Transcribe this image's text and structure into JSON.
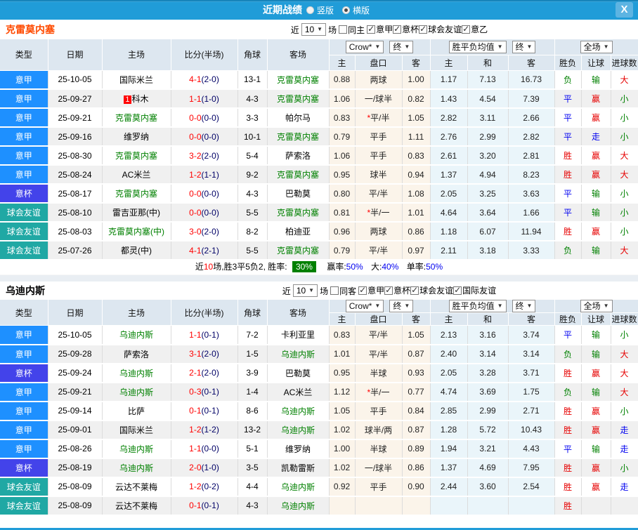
{
  "titlebar": {
    "title": "近期战绩",
    "radio_vertical": "竖版",
    "radio_horizontal": "横版",
    "close": "X"
  },
  "controls": {
    "near_label": "近",
    "count": "10",
    "matches_label": "场"
  },
  "columns": {
    "type": "类型",
    "date": "日期",
    "home": "主场",
    "score": "比分(半场)",
    "corner": "角球",
    "away": "客场",
    "dd_bookmaker": "Crow*",
    "dd_final1": "终",
    "dd_avg": "胜平负均值",
    "dd_final2": "终",
    "dd_full": "全场",
    "sub": [
      "主",
      "盘口",
      "客",
      "主",
      "和",
      "客",
      "胜负",
      "让球",
      "进球数"
    ]
  },
  "type_colors": {
    "意甲": "#1e90ff",
    "意杯": "#4343ea",
    "球会友谊": "#20a8a4"
  },
  "result_colors": {
    "red": "#e60000",
    "green": "#008000",
    "blue": "#0000f0"
  },
  "sections": [
    {
      "team": "克雷莫内塞",
      "same_label": "同主",
      "leagues": [
        "意甲",
        "意杯",
        "球会友谊",
        "意乙"
      ],
      "rows": [
        {
          "type": "意甲",
          "date": "25-10-05",
          "home": "国际米兰",
          "hb": "",
          "hg": 0,
          "ft": "4-1",
          "ht": "(2-0)",
          "corner": "13-1",
          "away": "克雷莫内塞",
          "ag": 1,
          "o1": "0.88",
          "hc": "两球",
          "star": 0,
          "o2": "1.00",
          "a1": "1.17",
          "a2": "7.13",
          "a3": "16.73",
          "r1": "负",
          "r1c": "g",
          "r2": "输",
          "r2c": "g",
          "r3": "大",
          "r3c": "r"
        },
        {
          "type": "意甲",
          "date": "25-09-27",
          "home": "科木",
          "hb": "1",
          "hg": 0,
          "ft": "1-1",
          "ht": "(1-0)",
          "corner": "4-3",
          "away": "克雷莫内塞",
          "ag": 1,
          "o1": "1.06",
          "hc": "一/球半",
          "star": 0,
          "o2": "0.82",
          "a1": "1.43",
          "a2": "4.54",
          "a3": "7.39",
          "r1": "平",
          "r1c": "b",
          "r2": "赢",
          "r2c": "r",
          "r3": "小",
          "r3c": "g"
        },
        {
          "type": "意甲",
          "date": "25-09-21",
          "home": "克雷莫内塞",
          "hb": "",
          "hg": 1,
          "ft": "0-0",
          "ht": "(0-0)",
          "corner": "3-3",
          "away": "帕尔马",
          "ag": 0,
          "o1": "0.83",
          "hc": "平/半",
          "star": 1,
          "o2": "1.05",
          "a1": "2.82",
          "a2": "3.11",
          "a3": "2.66",
          "r1": "平",
          "r1c": "b",
          "r2": "赢",
          "r2c": "r",
          "r3": "小",
          "r3c": "g"
        },
        {
          "type": "意甲",
          "date": "25-09-16",
          "home": "维罗纳",
          "hb": "",
          "hg": 0,
          "ft": "0-0",
          "ht": "(0-0)",
          "corner": "10-1",
          "away": "克雷莫内塞",
          "ag": 1,
          "o1": "0.79",
          "hc": "平手",
          "star": 0,
          "o2": "1.11",
          "a1": "2.76",
          "a2": "2.99",
          "a3": "2.82",
          "r1": "平",
          "r1c": "b",
          "r2": "走",
          "r2c": "b",
          "r3": "小",
          "r3c": "g"
        },
        {
          "type": "意甲",
          "date": "25-08-30",
          "home": "克雷莫内塞",
          "hb": "",
          "hg": 1,
          "ft": "3-2",
          "ht": "(2-0)",
          "corner": "5-4",
          "away": "萨索洛",
          "ag": 0,
          "o1": "1.06",
          "hc": "平手",
          "star": 0,
          "o2": "0.83",
          "a1": "2.61",
          "a2": "3.20",
          "a3": "2.81",
          "r1": "胜",
          "r1c": "r",
          "r2": "赢",
          "r2c": "r",
          "r3": "大",
          "r3c": "r"
        },
        {
          "type": "意甲",
          "date": "25-08-24",
          "home": "AC米兰",
          "hb": "",
          "hg": 0,
          "ft": "1-2",
          "ht": "(1-1)",
          "corner": "9-2",
          "away": "克雷莫内塞",
          "ag": 1,
          "o1": "0.95",
          "hc": "球半",
          "star": 0,
          "o2": "0.94",
          "a1": "1.37",
          "a2": "4.94",
          "a3": "8.23",
          "r1": "胜",
          "r1c": "r",
          "r2": "赢",
          "r2c": "r",
          "r3": "大",
          "r3c": "r"
        },
        {
          "type": "意杯",
          "date": "25-08-17",
          "home": "克雷莫内塞",
          "hb": "",
          "hg": 1,
          "ft": "0-0",
          "ht": "(0-0)",
          "corner": "4-3",
          "away": "巴勒莫",
          "ag": 0,
          "o1": "0.80",
          "hc": "平/半",
          "star": 0,
          "o2": "1.08",
          "a1": "2.05",
          "a2": "3.25",
          "a3": "3.63",
          "r1": "平",
          "r1c": "b",
          "r2": "输",
          "r2c": "g",
          "r3": "小",
          "r3c": "g"
        },
        {
          "type": "球会友谊",
          "date": "25-08-10",
          "home": "雷吉亚那(中)",
          "hb": "",
          "hg": 0,
          "ft": "0-0",
          "ht": "(0-0)",
          "corner": "5-5",
          "away": "克雷莫内塞",
          "ag": 1,
          "o1": "0.81",
          "hc": "半/一",
          "star": 1,
          "o2": "1.01",
          "a1": "4.64",
          "a2": "3.64",
          "a3": "1.66",
          "r1": "平",
          "r1c": "b",
          "r2": "输",
          "r2c": "g",
          "r3": "小",
          "r3c": "g"
        },
        {
          "type": "球会友谊",
          "date": "25-08-03",
          "home": "克雷莫内塞(中)",
          "hb": "",
          "hg": 1,
          "ft": "3-0",
          "ht": "(2-0)",
          "corner": "8-2",
          "away": "柏迪亚",
          "ag": 0,
          "o1": "0.96",
          "hc": "两球",
          "star": 0,
          "o2": "0.86",
          "a1": "1.18",
          "a2": "6.07",
          "a3": "11.94",
          "r1": "胜",
          "r1c": "r",
          "r2": "赢",
          "r2c": "r",
          "r3": "小",
          "r3c": "g"
        },
        {
          "type": "球会友谊",
          "date": "25-07-26",
          "home": "都灵(中)",
          "hb": "",
          "hg": 0,
          "ft": "4-1",
          "ht": "(2-1)",
          "corner": "5-5",
          "away": "克雷莫内塞",
          "ag": 1,
          "o1": "0.79",
          "hc": "平/半",
          "star": 0,
          "o2": "0.97",
          "a1": "2.11",
          "a2": "3.18",
          "a3": "3.33",
          "r1": "负",
          "r1c": "g",
          "r2": "输",
          "r2c": "g",
          "r3": "大",
          "r3c": "r"
        }
      ],
      "summary": {
        "near": "近",
        "count": "10",
        "mid": "场,胜3平5负2, 胜率:",
        "win_rate": "30%",
        "stats": [
          {
            "label": "赢率:",
            "value": "50%"
          },
          {
            "label": "大:",
            "value": "40%"
          },
          {
            "label": "单率:",
            "value": "50%"
          }
        ]
      }
    },
    {
      "team": "乌迪内斯",
      "same_label": "同客",
      "leagues": [
        "意甲",
        "意杯",
        "球会友谊",
        "国际友谊"
      ],
      "rows": [
        {
          "type": "意甲",
          "date": "25-10-05",
          "home": "乌迪内斯",
          "hb": "",
          "hg": 1,
          "ft": "1-1",
          "ht": "(0-1)",
          "corner": "7-2",
          "away": "卡利亚里",
          "ag": 0,
          "o1": "0.83",
          "hc": "平/半",
          "star": 0,
          "o2": "1.05",
          "a1": "2.13",
          "a2": "3.16",
          "a3": "3.74",
          "r1": "平",
          "r1c": "b",
          "r2": "输",
          "r2c": "g",
          "r3": "小",
          "r3c": "g"
        },
        {
          "type": "意甲",
          "date": "25-09-28",
          "home": "萨索洛",
          "hb": "",
          "hg": 0,
          "ft": "3-1",
          "ht": "(2-0)",
          "corner": "1-5",
          "away": "乌迪内斯",
          "ag": 1,
          "o1": "1.01",
          "hc": "平/半",
          "star": 0,
          "o2": "0.87",
          "a1": "2.40",
          "a2": "3.14",
          "a3": "3.14",
          "r1": "负",
          "r1c": "g",
          "r2": "输",
          "r2c": "g",
          "r3": "大",
          "r3c": "r"
        },
        {
          "type": "意杯",
          "date": "25-09-24",
          "home": "乌迪内斯",
          "hb": "",
          "hg": 1,
          "ft": "2-1",
          "ht": "(2-0)",
          "corner": "3-9",
          "away": "巴勒莫",
          "ag": 0,
          "o1": "0.95",
          "hc": "半球",
          "star": 0,
          "o2": "0.93",
          "a1": "2.05",
          "a2": "3.28",
          "a3": "3.71",
          "r1": "胜",
          "r1c": "r",
          "r2": "赢",
          "r2c": "r",
          "r3": "大",
          "r3c": "r"
        },
        {
          "type": "意甲",
          "date": "25-09-21",
          "home": "乌迪内斯",
          "hb": "",
          "hg": 1,
          "ft": "0-3",
          "ht": "(0-1)",
          "corner": "1-4",
          "away": "AC米兰",
          "ag": 0,
          "o1": "1.12",
          "hc": "半/一",
          "star": 1,
          "o2": "0.77",
          "a1": "4.74",
          "a2": "3.69",
          "a3": "1.75",
          "r1": "负",
          "r1c": "g",
          "r2": "输",
          "r2c": "g",
          "r3": "大",
          "r3c": "r"
        },
        {
          "type": "意甲",
          "date": "25-09-14",
          "home": "比萨",
          "hb": "",
          "hg": 0,
          "ft": "0-1",
          "ht": "(0-1)",
          "corner": "8-6",
          "away": "乌迪内斯",
          "ag": 1,
          "o1": "1.05",
          "hc": "平手",
          "star": 0,
          "o2": "0.84",
          "a1": "2.85",
          "a2": "2.99",
          "a3": "2.71",
          "r1": "胜",
          "r1c": "r",
          "r2": "赢",
          "r2c": "r",
          "r3": "小",
          "r3c": "g"
        },
        {
          "type": "意甲",
          "date": "25-09-01",
          "home": "国际米兰",
          "hb": "",
          "hg": 0,
          "ft": "1-2",
          "ht": "(1-2)",
          "corner": "13-2",
          "away": "乌迪内斯",
          "ag": 1,
          "o1": "1.02",
          "hc": "球半/两",
          "star": 0,
          "o2": "0.87",
          "a1": "1.28",
          "a2": "5.72",
          "a3": "10.43",
          "r1": "胜",
          "r1c": "r",
          "r2": "赢",
          "r2c": "r",
          "r3": "走",
          "r3c": "b"
        },
        {
          "type": "意甲",
          "date": "25-08-26",
          "home": "乌迪内斯",
          "hb": "",
          "hg": 1,
          "ft": "1-1",
          "ht": "(0-0)",
          "corner": "5-1",
          "away": "维罗纳",
          "ag": 0,
          "o1": "1.00",
          "hc": "半球",
          "star": 0,
          "o2": "0.89",
          "a1": "1.94",
          "a2": "3.21",
          "a3": "4.43",
          "r1": "平",
          "r1c": "b",
          "r2": "输",
          "r2c": "g",
          "r3": "走",
          "r3c": "b"
        },
        {
          "type": "意杯",
          "date": "25-08-19",
          "home": "乌迪内斯",
          "hb": "",
          "hg": 1,
          "ft": "2-0",
          "ht": "(1-0)",
          "corner": "3-5",
          "away": "凯勒雷斯",
          "ag": 0,
          "o1": "1.02",
          "hc": "一/球半",
          "star": 0,
          "o2": "0.86",
          "a1": "1.37",
          "a2": "4.69",
          "a3": "7.95",
          "r1": "胜",
          "r1c": "r",
          "r2": "赢",
          "r2c": "r",
          "r3": "小",
          "r3c": "g"
        },
        {
          "type": "球会友谊",
          "date": "25-08-09",
          "home": "云达不莱梅",
          "hb": "",
          "hg": 0,
          "ft": "1-2",
          "ht": "(0-2)",
          "corner": "4-4",
          "away": "乌迪内斯",
          "ag": 1,
          "o1": "0.92",
          "hc": "平手",
          "star": 0,
          "o2": "0.90",
          "a1": "2.44",
          "a2": "3.60",
          "a3": "2.54",
          "r1": "胜",
          "r1c": "r",
          "r2": "赢",
          "r2c": "r",
          "r3": "走",
          "r3c": "b"
        },
        {
          "type": "球会友谊",
          "date": "25-08-09",
          "home": "云达不莱梅",
          "hb": "",
          "hg": 0,
          "ft": "0-1",
          "ht": "(0-1)",
          "corner": "4-3",
          "away": "乌迪内斯",
          "ag": 1,
          "o1": "",
          "hc": "",
          "star": 0,
          "o2": "",
          "a1": "",
          "a2": "",
          "a3": "",
          "r1": "胜",
          "r1c": "r",
          "r2": "",
          "r2c": "",
          "r3": "",
          "r3c": ""
        }
      ],
      "summary": null
    }
  ]
}
